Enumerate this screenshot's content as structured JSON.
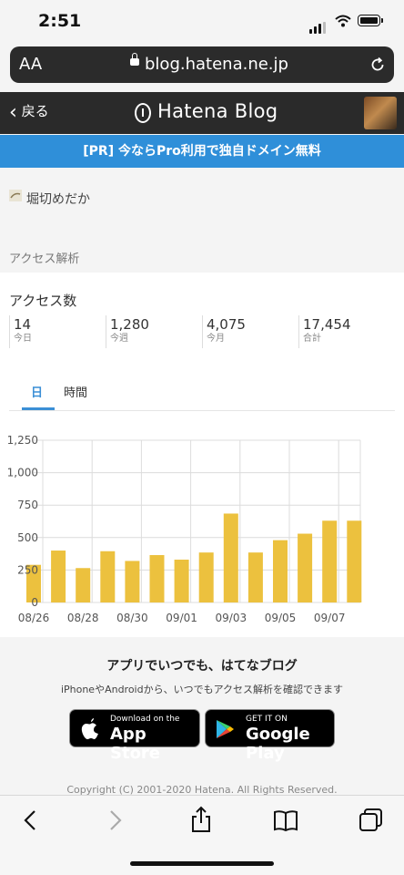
{
  "status": {
    "time": "2:51"
  },
  "browser": {
    "text_size_label": "AA",
    "url": "blog.hatena.ne.jp"
  },
  "header": {
    "back_label": "戻る",
    "logo": "Hatena Blog"
  },
  "banner": {
    "text": "[PR] 今ならPro利用で独自ドメイン無料"
  },
  "blog": {
    "name": "堀切めだか"
  },
  "section_label": "アクセス解析",
  "access": {
    "title": "アクセス数",
    "stats": [
      {
        "value": "14",
        "label": "今日"
      },
      {
        "value": "1,280",
        "label": "今週"
      },
      {
        "value": "4,075",
        "label": "今月"
      },
      {
        "value": "17,454",
        "label": "合計"
      }
    ]
  },
  "tabs": [
    {
      "label": "日",
      "active": true
    },
    {
      "label": "時間",
      "active": false
    }
  ],
  "chart_data": {
    "type": "bar",
    "categories": [
      "08/26",
      "08/27",
      "08/28",
      "08/29",
      "08/30",
      "08/31",
      "09/01",
      "09/02",
      "09/03",
      "09/04",
      "09/05",
      "09/06",
      "09/07",
      "09/08"
    ],
    "values": [
      290,
      400,
      265,
      395,
      320,
      365,
      330,
      385,
      685,
      385,
      480,
      530,
      630,
      630
    ],
    "x_tick_labels": [
      "08/26",
      "08/28",
      "08/30",
      "09/01",
      "09/03",
      "09/05",
      "09/07"
    ],
    "y_ticks": [
      0,
      250,
      500,
      750,
      1000,
      1250
    ],
    "y_tick_labels": [
      "0",
      "250",
      "500",
      "750",
      "1,000",
      "1,250"
    ],
    "ylim": [
      0,
      1250
    ],
    "grid": true,
    "bar_color": "#ecc13e"
  },
  "promo": {
    "title": "アプリでいつでも、はてなブログ",
    "subtitle": "iPhoneやAndroidから、いつでもアクセス解析を確認できます",
    "app_store": {
      "small": "Download on the",
      "big": "App Store"
    },
    "google_play": {
      "small": "GET IT ON",
      "big": "Google Play"
    }
  },
  "footer": {
    "copyright": "Copyright (C) 2001-2020 Hatena. All Rights Reserved."
  },
  "colors": {
    "accent": "#2f8fd9",
    "header_bg": "#2a2a2a",
    "bar": "#ecc13e"
  }
}
